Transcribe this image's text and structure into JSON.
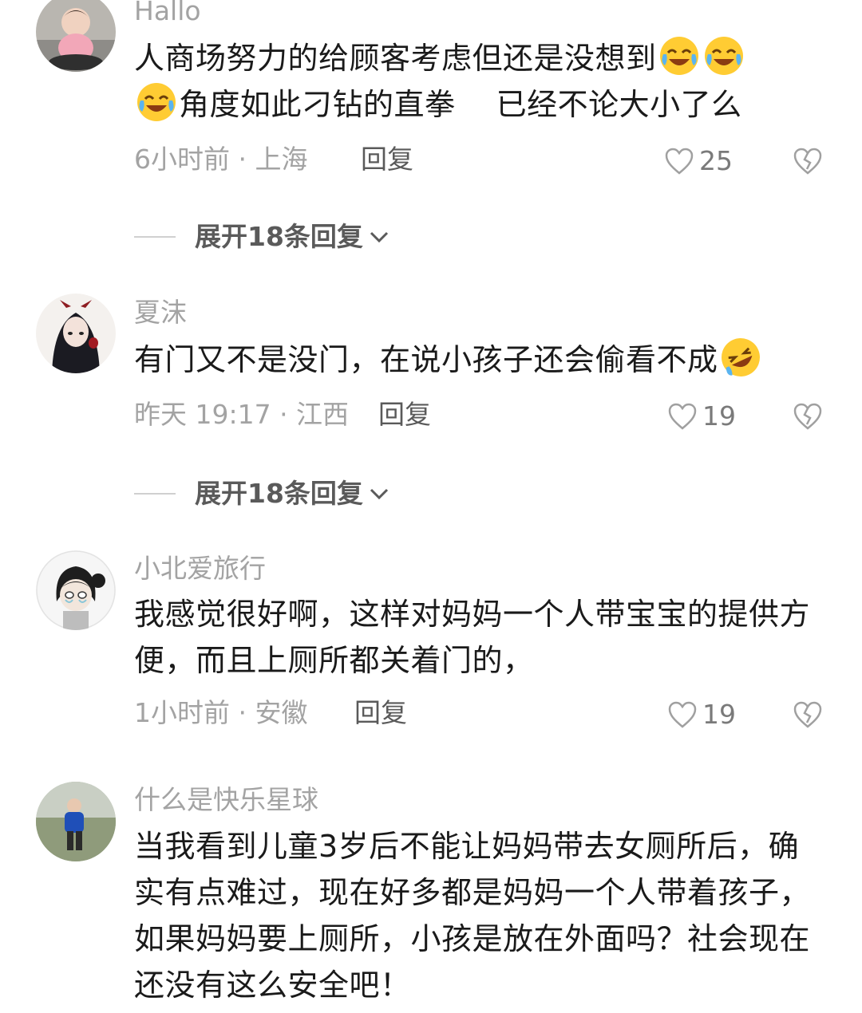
{
  "comments": [
    {
      "username": "Hallo",
      "text_parts": [
        "人商场努力的给顾客考虑但还是没想到",
        "角度如此刁钻的直拳　 已经不论大小了么"
      ],
      "emojis": [
        "crying-laughing-emoji",
        "crying-laughing-emoji",
        "crying-laughing-emoji"
      ],
      "time_location": "6小时前 · 上海",
      "reply_label": "回复",
      "like_count": "25",
      "expand_label": "展开18条回复"
    },
    {
      "username": "夏沫",
      "text": "有门又不是没门，在说小孩子还会偷看不成",
      "emojis": [
        "rolling-laughing-emoji"
      ],
      "time_location": "昨天 19:17 · 江西",
      "reply_label": "回复",
      "like_count": "19",
      "expand_label": "展开18条回复"
    },
    {
      "username": "小北爱旅行",
      "text": "我感觉很好啊，这样对妈妈一个人带宝宝的提供方便，而且上厕所都关着门的，",
      "time_location": "1小时前 · 安徽",
      "reply_label": "回复",
      "like_count": "19"
    },
    {
      "username": "什么是快乐星球",
      "text": "当我看到儿童3岁后不能让妈妈带去女厕所后，确实有点难过，现在好多都是妈妈一个人带着孩子，如果妈妈要上厕所，小孩是放在外面吗？社会现在还没有这么安全吧！"
    }
  ],
  "colors": {
    "text": "#1a1a1a",
    "muted": "#a3a3a3",
    "action": "#5a5a5a",
    "background": "#ffffff"
  },
  "icons": [
    "heart-outline-icon",
    "broken-heart-icon",
    "chevron-down-icon"
  ]
}
